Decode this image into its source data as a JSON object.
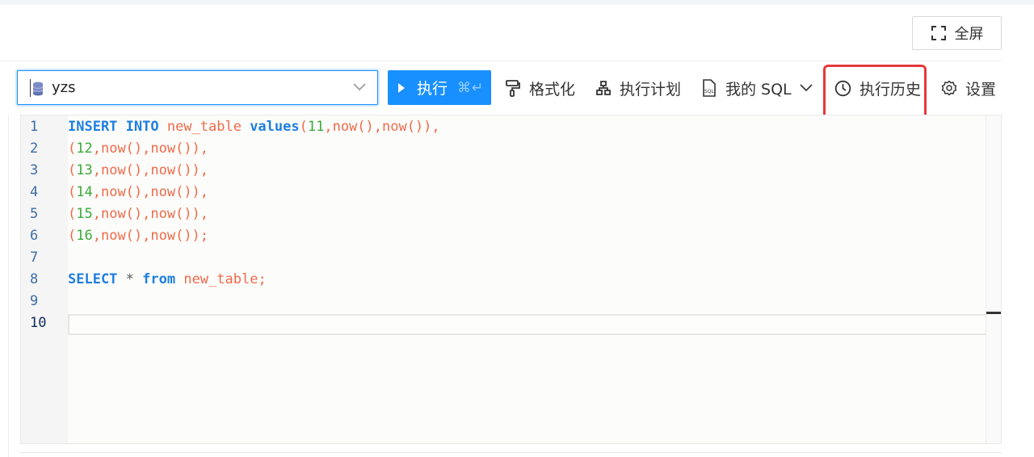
{
  "header": {
    "fullscreen_label": "全屏"
  },
  "toolbar": {
    "db_select_value": "yzs",
    "run_label": "执行",
    "run_shortcut": "⌘↵",
    "format_label": "格式化",
    "plan_label": "执行计划",
    "my_sql_label": "我的 SQL",
    "history_label": "执行历史",
    "settings_label": "设置"
  },
  "editor": {
    "line_numbers": [
      "1",
      "2",
      "3",
      "4",
      "5",
      "6",
      "7",
      "8",
      "9",
      "10"
    ],
    "lines": [
      [
        {
          "t": "INSERT INTO ",
          "c": "kw"
        },
        {
          "t": "new_table ",
          "c": "id"
        },
        {
          "t": "values",
          "c": "kw"
        },
        {
          "t": "(",
          "c": "id"
        },
        {
          "t": "11",
          "c": "num"
        },
        {
          "t": ",now(),now()),",
          "c": "id"
        }
      ],
      [
        {
          "t": "(",
          "c": "id"
        },
        {
          "t": "12",
          "c": "num"
        },
        {
          "t": ",now(),now()),",
          "c": "id"
        }
      ],
      [
        {
          "t": "(",
          "c": "id"
        },
        {
          "t": "13",
          "c": "num"
        },
        {
          "t": ",now(),now()),",
          "c": "id"
        }
      ],
      [
        {
          "t": "(",
          "c": "id"
        },
        {
          "t": "14",
          "c": "num"
        },
        {
          "t": ",now(),now()),",
          "c": "id"
        }
      ],
      [
        {
          "t": "(",
          "c": "id"
        },
        {
          "t": "15",
          "c": "num"
        },
        {
          "t": ",now(),now()),",
          "c": "id"
        }
      ],
      [
        {
          "t": "(",
          "c": "id"
        },
        {
          "t": "16",
          "c": "num"
        },
        {
          "t": ",now(),now());",
          "c": "id"
        }
      ],
      [],
      [
        {
          "t": "SELECT ",
          "c": "kw"
        },
        {
          "t": "* ",
          "c": "op"
        },
        {
          "t": "from ",
          "c": "kw"
        },
        {
          "t": "new_table;",
          "c": "id"
        }
      ],
      [],
      []
    ],
    "active_line": 10
  },
  "colors": {
    "primary": "#1890ff",
    "highlight": "#e5383b",
    "keyword": "#1e7fe0",
    "identifier": "#ef6b4a",
    "number": "#3cab3c"
  }
}
